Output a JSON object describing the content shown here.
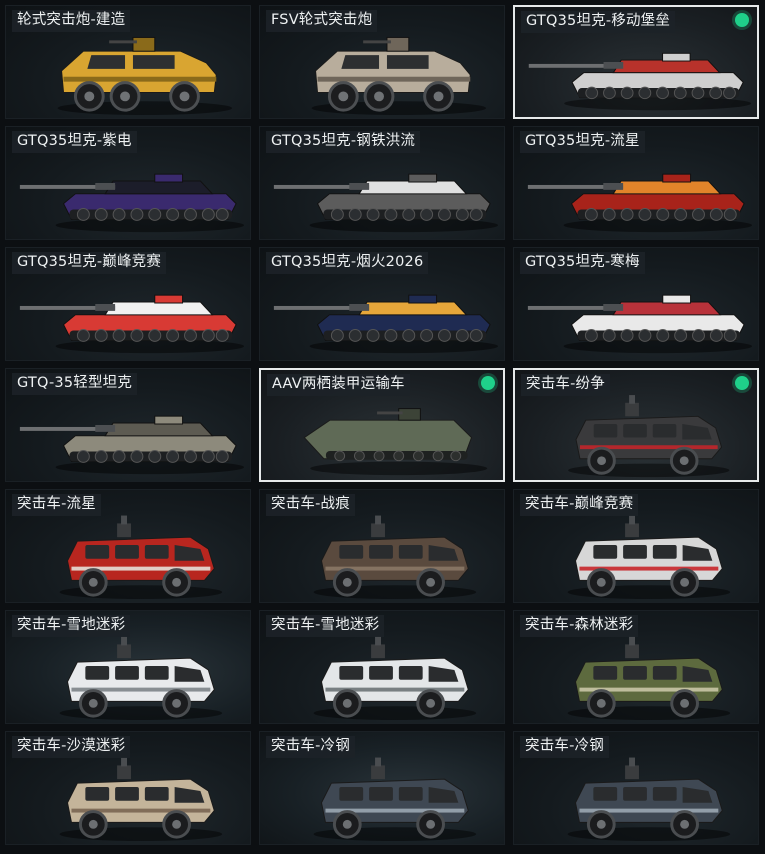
{
  "tiles": [
    {
      "label": "轮式突击炮-建造",
      "vehicle": "wheeled-assault-gun-icon",
      "primary": "#d9a531",
      "secondary": "#8a6a1a",
      "selected": false,
      "owned": false
    },
    {
      "label": "FSV轮式突击炮",
      "vehicle": "wheeled-assault-gun-icon",
      "primary": "#b8ad9c",
      "secondary": "#6f665a",
      "selected": false,
      "owned": false
    },
    {
      "label": "GTQ35坦克-移动堡垒",
      "vehicle": "tank-icon",
      "primary": "#cfcfcf",
      "secondary": "#b8322b",
      "selected": true,
      "owned": true
    },
    {
      "label": "GTQ35坦克-紫电",
      "vehicle": "tank-icon",
      "primary": "#3a2a6e",
      "secondary": "#1c1d2a",
      "selected": false,
      "owned": false
    },
    {
      "label": "GTQ35坦克-钢铁洪流",
      "vehicle": "tank-icon",
      "primary": "#5c5c5c",
      "secondary": "#e0e0e0",
      "selected": false,
      "owned": false
    },
    {
      "label": "GTQ35坦克-流星",
      "vehicle": "tank-icon",
      "primary": "#a8231a",
      "secondary": "#e2842a",
      "selected": false,
      "owned": false
    },
    {
      "label": "GTQ35坦克-巅峰竞赛",
      "vehicle": "tank-icon",
      "primary": "#d83a34",
      "secondary": "#f1f1f1",
      "selected": false,
      "owned": false
    },
    {
      "label": "GTQ35坦克-烟火2026",
      "vehicle": "tank-icon",
      "primary": "#1f2b52",
      "secondary": "#e6a63a",
      "selected": false,
      "owned": false
    },
    {
      "label": "GTQ35坦克-寒梅",
      "vehicle": "tank-icon",
      "primary": "#e9e9e9",
      "secondary": "#b8323a",
      "selected": false,
      "owned": false
    },
    {
      "label": "GTQ-35轻型坦克",
      "vehicle": "tank-icon",
      "primary": "#8d8a7c",
      "secondary": "#5d5b52",
      "selected": false,
      "owned": false
    },
    {
      "label": "AAV两栖装甲运输车",
      "vehicle": "amphibious-carrier-icon",
      "primary": "#5f6a56",
      "secondary": "#3c4337",
      "selected": true,
      "owned": false
    },
    {
      "label": "突击车-纷争",
      "vehicle": "assault-vehicle-icon",
      "primary": "#3a3a3c",
      "secondary": "#c2262a",
      "selected": true,
      "owned": true
    },
    {
      "label": "突击车-流星",
      "vehicle": "assault-vehicle-icon",
      "primary": "#b8261f",
      "secondary": "#e5e0d8",
      "selected": false,
      "owned": false
    },
    {
      "label": "突击车-战痕",
      "vehicle": "assault-vehicle-icon",
      "primary": "#5a4a3e",
      "secondary": "#8a7866",
      "selected": false,
      "owned": false
    },
    {
      "label": "突击车-巅峰竞赛",
      "vehicle": "assault-vehicle-icon",
      "primary": "#d7d7d7",
      "secondary": "#c8262a",
      "selected": false,
      "owned": false
    },
    {
      "label": "突击车-雪地迷彩",
      "vehicle": "assault-vehicle-icon",
      "primary": "#e8eaec",
      "secondary": "#7d8488",
      "selected": false,
      "owned": false
    },
    {
      "label": "突击车-雪地迷彩",
      "vehicle": "assault-vehicle-icon",
      "primary": "#e3e6e8",
      "secondary": "#6c7377",
      "selected": false,
      "owned": false
    },
    {
      "label": "突击车-森林迷彩",
      "vehicle": "assault-vehicle-icon",
      "primary": "#5d6a3e",
      "secondary": "#c9c7a6",
      "selected": false,
      "owned": false
    },
    {
      "label": "突击车-沙漠迷彩",
      "vehicle": "assault-vehicle-icon",
      "primary": "#c4b49a",
      "secondary": "#7a6552",
      "selected": false,
      "owned": false
    },
    {
      "label": "突击车-冷钢",
      "vehicle": "assault-vehicle-icon",
      "primary": "#3f4853",
      "secondary": "#9ba7b2",
      "selected": false,
      "owned": false
    },
    {
      "label": "突击车-冷钢",
      "vehicle": "assault-vehicle-icon",
      "primary": "#3f4853",
      "secondary": "#9ba7b2",
      "selected": false,
      "owned": false
    }
  ]
}
